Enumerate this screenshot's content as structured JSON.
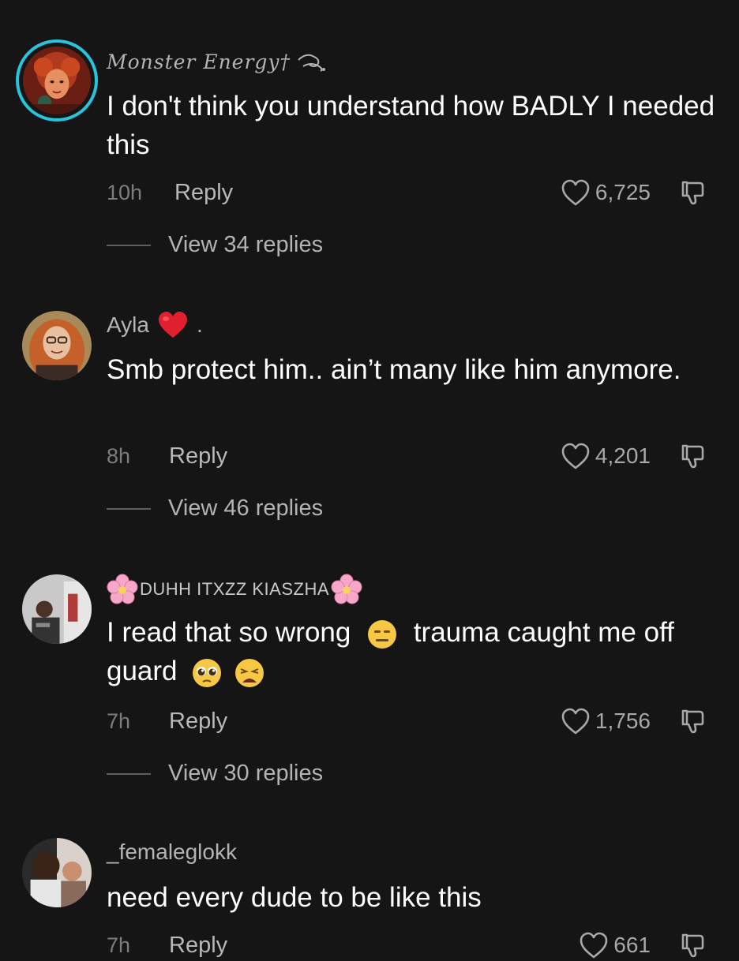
{
  "comments": [
    {
      "username": "Monster Energy†",
      "text": "I don't think you understand how BADLY I needed this",
      "time": "10h",
      "reply_label": "Reply",
      "likes": "6,725",
      "view_replies": "View 34 replies"
    },
    {
      "username": "Ayla",
      "username_suffix": ".",
      "text": "Smb protect him.. ain’t many like him anymore.",
      "time": "8h",
      "reply_label": "Reply",
      "likes": "4,201",
      "view_replies": "View 46 replies"
    },
    {
      "username": "DUHH ITXZZ KIASZHA",
      "text_part1": "I read that so wrong",
      "text_part2": "trauma caught me off guard",
      "time": "7h",
      "reply_label": "Reply",
      "likes": "1,756",
      "view_replies": "View 30 replies"
    },
    {
      "username": "_femaleglokk",
      "text": "need every dude to be like this",
      "time": "7h",
      "reply_label": "Reply",
      "likes": "661"
    }
  ],
  "colors": {
    "background": "#151515",
    "story_ring": "#27c4da",
    "secondary_text": "#b4b4b4"
  },
  "icons": [
    "heart-outline-icon",
    "thumbs-down-icon",
    "heart-emoji",
    "cherry-blossom-emoji",
    "expressionless-face-emoji",
    "pleading-face-emoji",
    "weary-face-emoji",
    "flourish-icon"
  ]
}
